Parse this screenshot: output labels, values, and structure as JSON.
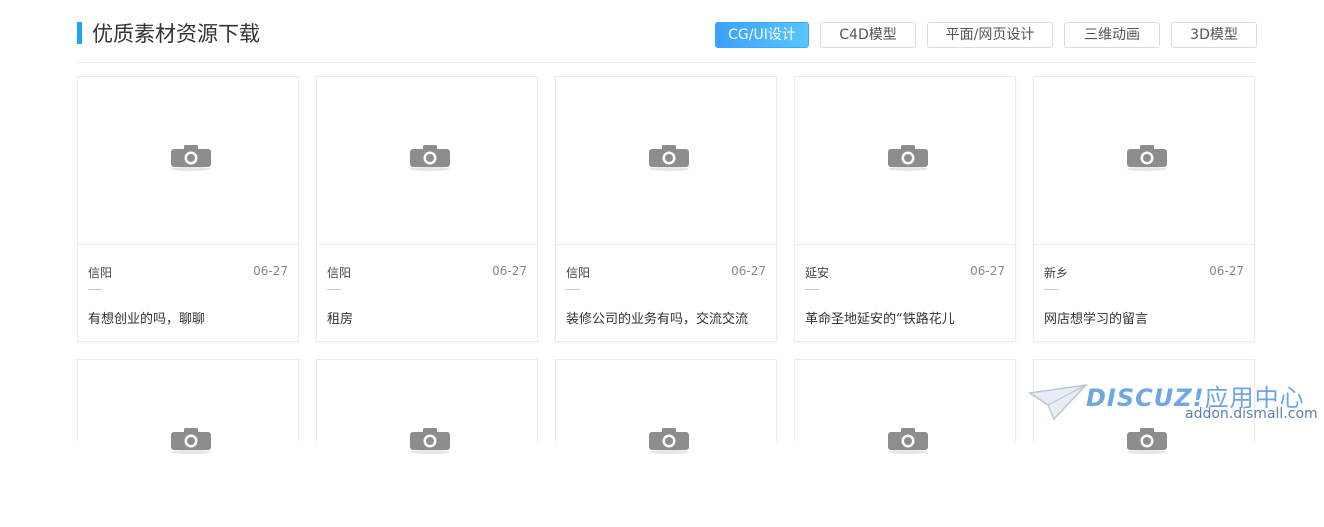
{
  "section": {
    "title": "优质素材资源下载",
    "tabs": [
      {
        "label": "CG/UI设计",
        "active": true
      },
      {
        "label": "C4D模型",
        "active": false
      },
      {
        "label": "平面/网页设计",
        "active": false
      },
      {
        "label": "三维动画",
        "active": false
      },
      {
        "label": "3D模型",
        "active": false
      }
    ]
  },
  "cards": [
    {
      "city": "信阳",
      "date": "06-27",
      "desc": "有想创业的吗，聊聊",
      "icon": "camera-placeholder-icon"
    },
    {
      "city": "信阳",
      "date": "06-27",
      "desc": "租房",
      "icon": "camera-placeholder-icon"
    },
    {
      "city": "信阳",
      "date": "06-27",
      "desc": "装修公司的业务有吗，交流交流",
      "icon": "camera-placeholder-icon"
    },
    {
      "city": "延安",
      "date": "06-27",
      "desc": "革命圣地延安的“铁路花儿",
      "icon": "camera-placeholder-icon"
    },
    {
      "city": "新乡",
      "date": "06-27",
      "desc": "网店想学习的留言",
      "icon": "camera-placeholder-icon"
    }
  ],
  "watermark": {
    "brand": "DISCUZ!",
    "tagline": "应用中心",
    "url": "addon.dismall.com"
  },
  "colors": {
    "accent": "#1fa3ff",
    "active_tab_start": "#3ba0ff",
    "active_tab_end": "#58c6ff",
    "border": "#ececec"
  }
}
